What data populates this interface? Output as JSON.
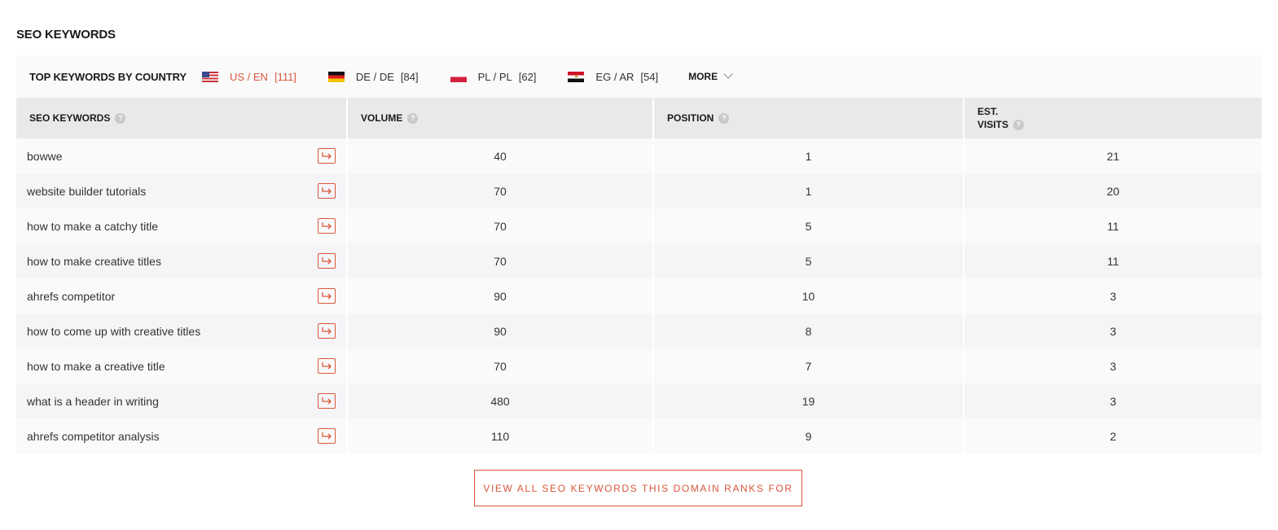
{
  "section_title": "SEO KEYWORDS",
  "country_bar": {
    "label": "TOP KEYWORDS BY COUNTRY",
    "countries": [
      {
        "name": "US / EN",
        "count": "[111]",
        "flag": "us-flag-icon",
        "active": true
      },
      {
        "name": "DE / DE",
        "count": "[84]",
        "flag": "de-flag-icon",
        "active": false
      },
      {
        "name": "PL / PL",
        "count": "[62]",
        "flag": "pl-flag-icon",
        "active": false
      },
      {
        "name": "EG / AR",
        "count": "[54]",
        "flag": "eg-flag-icon",
        "active": false
      }
    ],
    "more_label": "MORE"
  },
  "table": {
    "headers": {
      "keyword": "SEO KEYWORDS",
      "volume": "VOLUME",
      "position": "POSITION",
      "visits_line1": "EST.",
      "visits_line2": "VISITS"
    },
    "help_glyph": "?",
    "rows": [
      {
        "keyword": "bowwe",
        "volume": "40",
        "position": "1",
        "visits": "21"
      },
      {
        "keyword": "website builder tutorials",
        "volume": "70",
        "position": "1",
        "visits": "20"
      },
      {
        "keyword": "how to make a catchy title",
        "volume": "70",
        "position": "5",
        "visits": "11"
      },
      {
        "keyword": "how to make creative titles",
        "volume": "70",
        "position": "5",
        "visits": "11"
      },
      {
        "keyword": "ahrefs competitor",
        "volume": "90",
        "position": "10",
        "visits": "3"
      },
      {
        "keyword": "how to come up with creative titles",
        "volume": "90",
        "position": "8",
        "visits": "3"
      },
      {
        "keyword": "how to make a creative title",
        "volume": "70",
        "position": "7",
        "visits": "3"
      },
      {
        "keyword": "what is a header in writing",
        "volume": "480",
        "position": "19",
        "visits": "3"
      },
      {
        "keyword": "ahrefs competitor analysis",
        "volume": "110",
        "position": "9",
        "visits": "2"
      }
    ]
  },
  "view_all_label": "VIEW ALL SEO KEYWORDS THIS DOMAIN RANKS FOR",
  "colors": {
    "accent": "#d9573a",
    "header_bg": "#e9e9ec",
    "row_bg": "#fafafb"
  }
}
